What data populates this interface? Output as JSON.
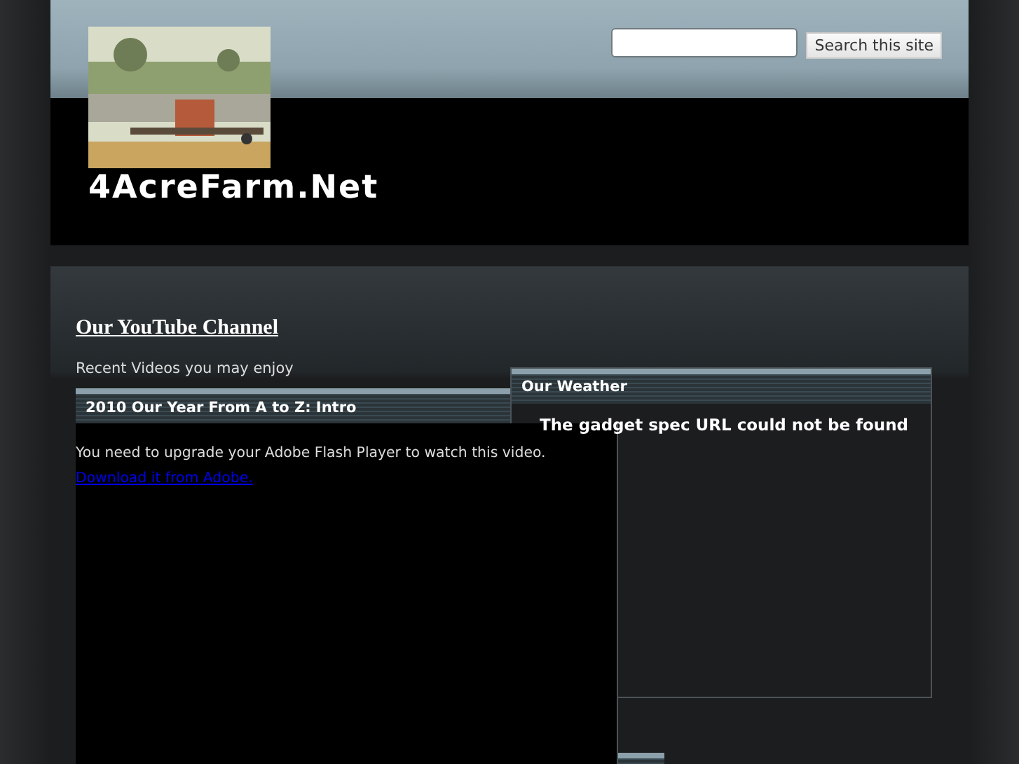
{
  "header": {
    "site_title": "4AcreFarm.Net",
    "search": {
      "button": "Search this site"
    }
  },
  "youtube": {
    "heading": "Our YouTube Channel",
    "intro": "Recent Videos you may enjoy",
    "video_title": "2010 Our Year From A to Z: Intro",
    "message": "You need to upgrade your Adobe Flash Player to watch this video.",
    "link": "Download it from Adobe."
  },
  "weather": {
    "title": "Our Weather",
    "message": "The gadget spec URL could not be found"
  }
}
